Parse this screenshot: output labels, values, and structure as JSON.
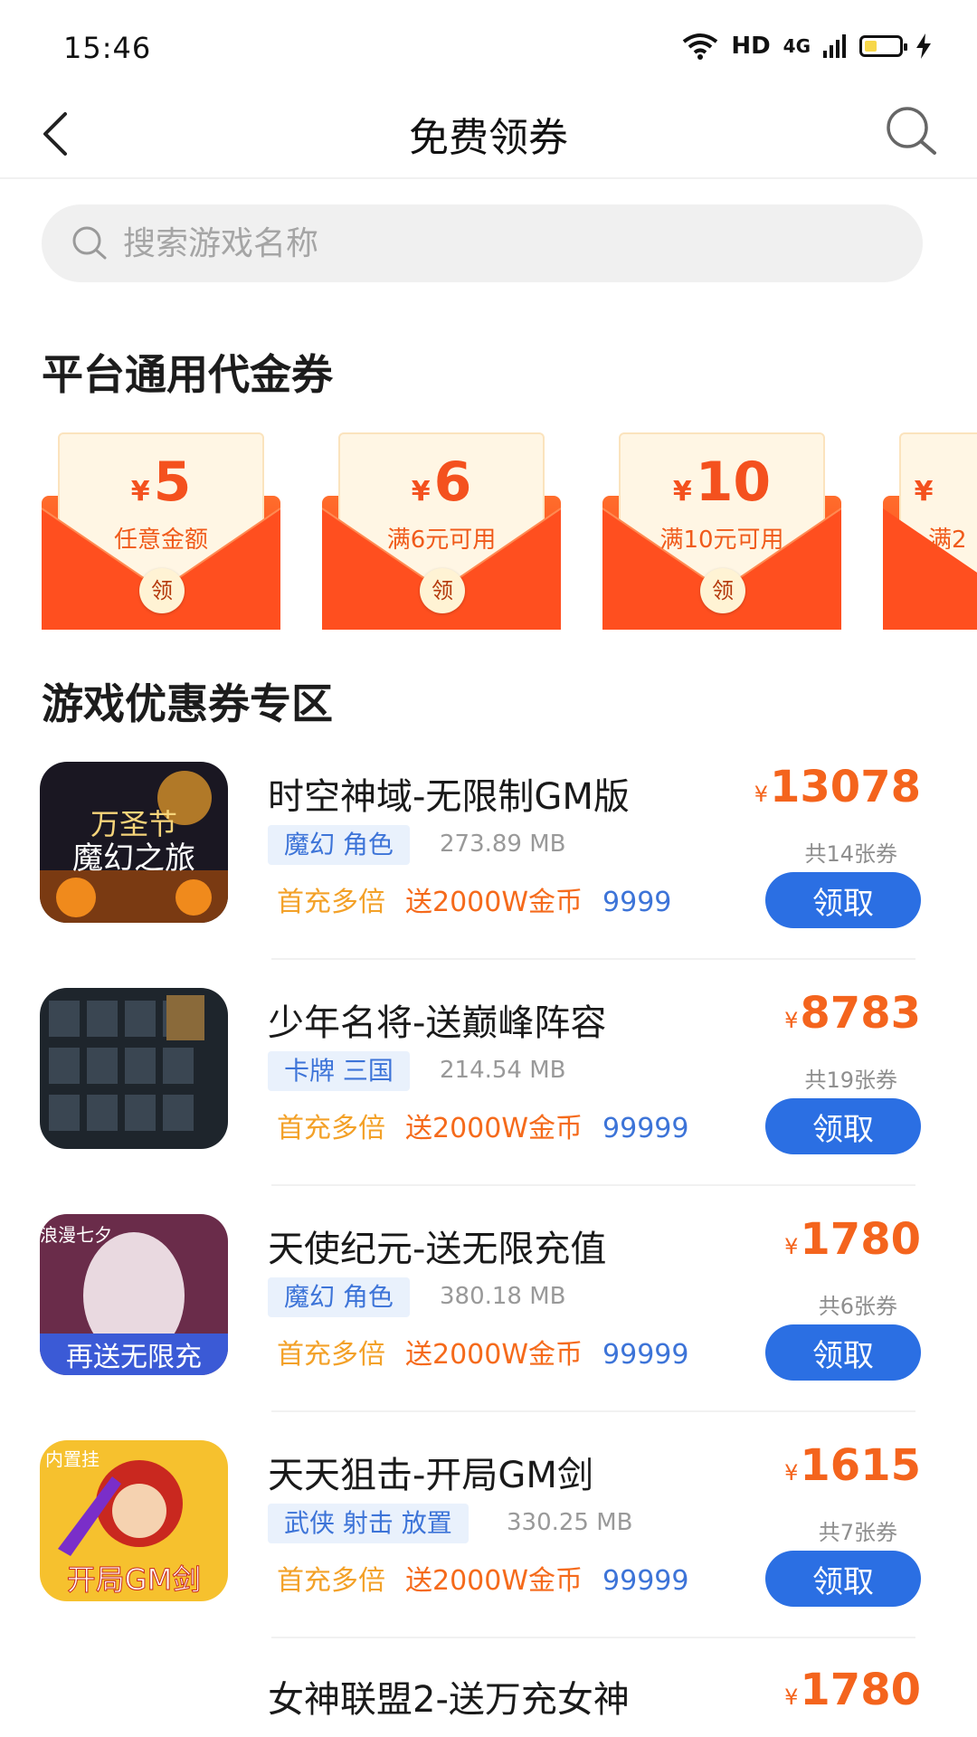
{
  "status_bar": {
    "time": "15:46",
    "network_label": "HD",
    "cell_label": "4G"
  },
  "nav": {
    "title": "免费领券"
  },
  "search": {
    "placeholder": "搜索游戏名称"
  },
  "sections": {
    "platform_title": "平台通用代金券",
    "game_title": "游戏优惠券专区"
  },
  "coupons": [
    {
      "currency": "¥",
      "amount": "5",
      "condition": "任意金额",
      "seal": "领"
    },
    {
      "currency": "¥",
      "amount": "6",
      "condition": "满6元可用",
      "seal": "领"
    },
    {
      "currency": "¥",
      "amount": "10",
      "condition": "满10元可用",
      "seal": "领"
    },
    {
      "currency": "¥",
      "amount": "",
      "condition": "满2",
      "seal": ""
    }
  ],
  "games": [
    {
      "name": "时空神域-无限制GM版",
      "tags": "魔幻 角色",
      "size": "273.89 MB",
      "perks": [
        "首充多倍",
        "送2000W金币",
        "9999"
      ],
      "currency": "¥",
      "price": "13078",
      "count": "共14张券",
      "button": "领取",
      "icon_colors": [
        "#1a1722",
        "#7a3a12",
        "#f2a42b"
      ]
    },
    {
      "name": "少年名将-送巅峰阵容",
      "tags": "卡牌 三国",
      "size": "214.54 MB",
      "perks": [
        "首充多倍",
        "送2000W金币",
        "99999"
      ],
      "currency": "¥",
      "price": "8783",
      "count": "共19张券",
      "button": "领取",
      "icon_colors": [
        "#1e252c",
        "#3a4652",
        "#8a6a3a"
      ]
    },
    {
      "name": "天使纪元-送无限充值",
      "tags": "魔幻 角色",
      "size": "380.18 MB",
      "perks": [
        "首充多倍",
        "送2000W金币",
        "99999"
      ],
      "currency": "¥",
      "price": "1780",
      "count": "共6张券",
      "button": "领取",
      "icon_colors": [
        "#6a2c4a",
        "#e9d9e0",
        "#3b5ad6"
      ]
    },
    {
      "name": "天天狙击-开局GM剑",
      "tags": "武侠 射击 放置",
      "size": "330.25 MB",
      "perks": [
        "首充多倍",
        "送2000W金币",
        "99999"
      ],
      "currency": "¥",
      "price": "1615",
      "count": "共7张券",
      "button": "领取",
      "icon_colors": [
        "#c9281f",
        "#f6c12e",
        "#7a2ec9"
      ]
    },
    {
      "name": "女神联盟2-送万充女神",
      "tags": "",
      "size": "",
      "perks": [],
      "currency": "¥",
      "price": "1780",
      "count": "",
      "button": "",
      "icon_colors": [
        "#ffffff",
        "#ffffff",
        "#ffffff"
      ]
    }
  ]
}
